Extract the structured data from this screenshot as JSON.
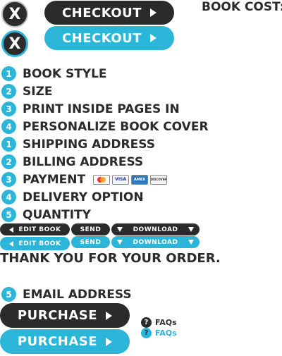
{
  "header": {
    "close_label": "X",
    "checkout_label": "CHECKOUT",
    "book_cost_label": "BOOK COST:"
  },
  "steps_book": [
    {
      "num": "1",
      "label": "BOOK STYLE"
    },
    {
      "num": "2",
      "label": "SIZE"
    },
    {
      "num": "3",
      "label": "PRINT INSIDE PAGES IN"
    },
    {
      "num": "4",
      "label": "PERSONALIZE BOOK COVER"
    }
  ],
  "steps_order": [
    {
      "num": "1",
      "label": "SHIPPING ADDRESS"
    },
    {
      "num": "2",
      "label": "BILLING ADDRESS"
    },
    {
      "num": "3",
      "label": "PAYMENT"
    },
    {
      "num": "4",
      "label": "DELIVERY OPTION"
    },
    {
      "num": "5",
      "label": "QUANTITY"
    }
  ],
  "payment_cards": [
    "mastercard-icon",
    "VISA",
    "AMEX",
    "DISCOVER"
  ],
  "actions": {
    "edit_book": "EDIT BOOK",
    "send": "SEND",
    "download": "DOWNLOAD"
  },
  "thank_you": "THANK YOU FOR YOUR ORDER.",
  "email_step": {
    "num": "5",
    "label": "EMAIL ADDRESS"
  },
  "purchase_label": "PURCHASE",
  "faq_label": "FAQs",
  "colors": {
    "dark": "#2b2b2b",
    "accent": "#2bb5d8"
  }
}
